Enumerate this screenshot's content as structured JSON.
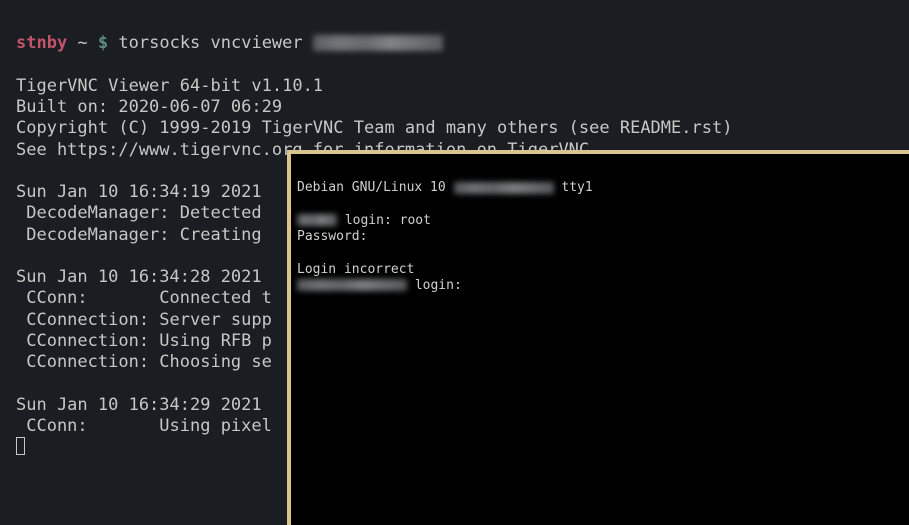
{
  "prompt": {
    "user": "stnby",
    "sep": " ~ ",
    "symbol": "$",
    "command": "torsocks vncviewer "
  },
  "terminal": {
    "l1": "TigerVNC Viewer 64-bit v1.10.1",
    "l2": "Built on: 2020-06-07 06:29",
    "l3": "Copyright (C) 1999-2019 TigerVNC Team and many others (see README.rst)",
    "l4": "See https://www.tigervnc.org for information on TigerVNC.",
    "l5": "Sun Jan 10 16:34:19 2021",
    "l6": " DecodeManager: Detected ",
    "l7": " DecodeManager: Creating ",
    "l8": "Sun Jan 10 16:34:28 2021",
    "l9": " CConn:       Connected t",
    "l10": " CConnection: Server supp",
    "l11": " CConnection: Using RFB p",
    "l12": " CConnection: Choosing se",
    "l13": "Sun Jan 10 16:34:29 2021",
    "l14": " CConn:       Using pixel"
  },
  "vnc": {
    "l1a": "Debian GNU/Linux 10 ",
    "l1b": " tty1",
    "l2a": " login: root",
    "l3": "Password:",
    "l4": "Login incorrect",
    "l5b": " login:"
  }
}
